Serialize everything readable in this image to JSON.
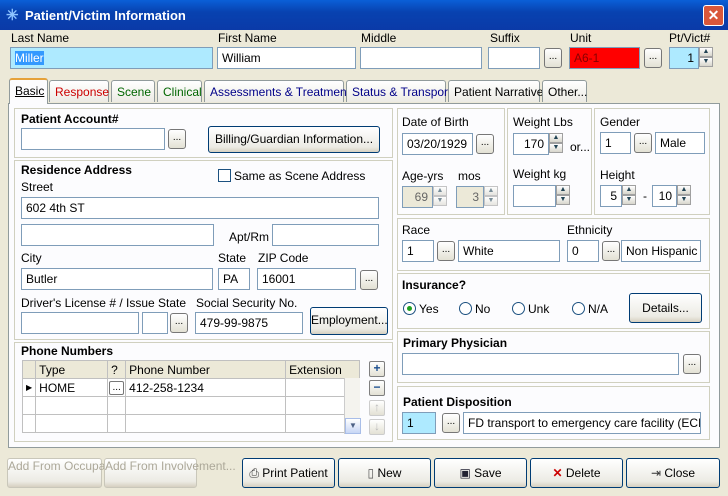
{
  "window": {
    "title": "Patient/Victim Information"
  },
  "top": {
    "last_name_label": "Last Name",
    "last_name": "Miller",
    "first_name_label": "First Name",
    "first_name": "William",
    "middle_label": "Middle",
    "middle": "",
    "suffix_label": "Suffix",
    "suffix": "",
    "unit_label": "Unit",
    "unit": "A6-1",
    "ptvict_label": "Pt/Vict#",
    "ptvict": "1"
  },
  "tabs": [
    "Basic",
    "Response",
    "Scene",
    "Clinical",
    "Assessments & Treatments",
    "Status & Transport",
    "Patient Narrative",
    "Other..."
  ],
  "account": {
    "header": "Patient Account#",
    "value": "",
    "billing_button": "Billing/Guardian Information..."
  },
  "residence": {
    "header": "Residence Address",
    "same_as_scene": "Same as Scene Address",
    "street_label": "Street",
    "street": "602 4th ST",
    "street2": "",
    "apt_label": "Apt/Rm",
    "apt": "",
    "city_label": "City",
    "city": "Butler",
    "state_label": "State",
    "state": "PA",
    "zip_label": "ZIP Code",
    "zip": "16001",
    "dl_label": "Driver's License # / Issue State",
    "dl": "",
    "dl_state": "",
    "ssn_label": "Social Security No.",
    "ssn": "479-99-9875",
    "employment_button": "Employment..."
  },
  "phones": {
    "header": "Phone Numbers",
    "columns": [
      "Type",
      "?",
      "Phone Number",
      "Extension"
    ],
    "rows": [
      {
        "type": "HOME",
        "phone": "412-258-1234",
        "ext": ""
      }
    ]
  },
  "dob": {
    "label": "Date of Birth",
    "value": "03/20/1929",
    "age_label": "Age-yrs",
    "age": "69",
    "mos_label": "mos",
    "mos": "3"
  },
  "weight": {
    "lbs_label": "Weight Lbs",
    "lbs": "170",
    "or": "or...",
    "kg_label": "Weight kg",
    "kg": ""
  },
  "gender": {
    "label": "Gender",
    "code": "1",
    "value": "Male",
    "height_label": "Height",
    "feet": "5",
    "dash": "-",
    "inches": "10"
  },
  "race": {
    "label": "Race",
    "code": "1",
    "value": "White",
    "eth_label": "Ethnicity",
    "eth_code": "0",
    "eth_value": "Non Hispanic or Latino"
  },
  "insurance": {
    "header": "Insurance?",
    "options": [
      "Yes",
      "No",
      "Unk",
      "N/A"
    ],
    "selected": "Yes",
    "details_button": "Details..."
  },
  "physician": {
    "header": "Primary Physician",
    "value": ""
  },
  "disposition": {
    "header": "Patient Disposition",
    "code": "1",
    "value": "FD transport to emergency care facility (ECF)"
  },
  "footer": {
    "add_occupancy": "Add From Occupancy...",
    "add_involvement": "Add From Involvement...",
    "print": "Print Patient",
    "new": "New",
    "save": "Save",
    "delete": "Delete",
    "close": "Close"
  },
  "colors": {
    "title_bar": "#0a52c8",
    "unit_field": "#ff0000",
    "highlight_field": "#aeeaff"
  }
}
